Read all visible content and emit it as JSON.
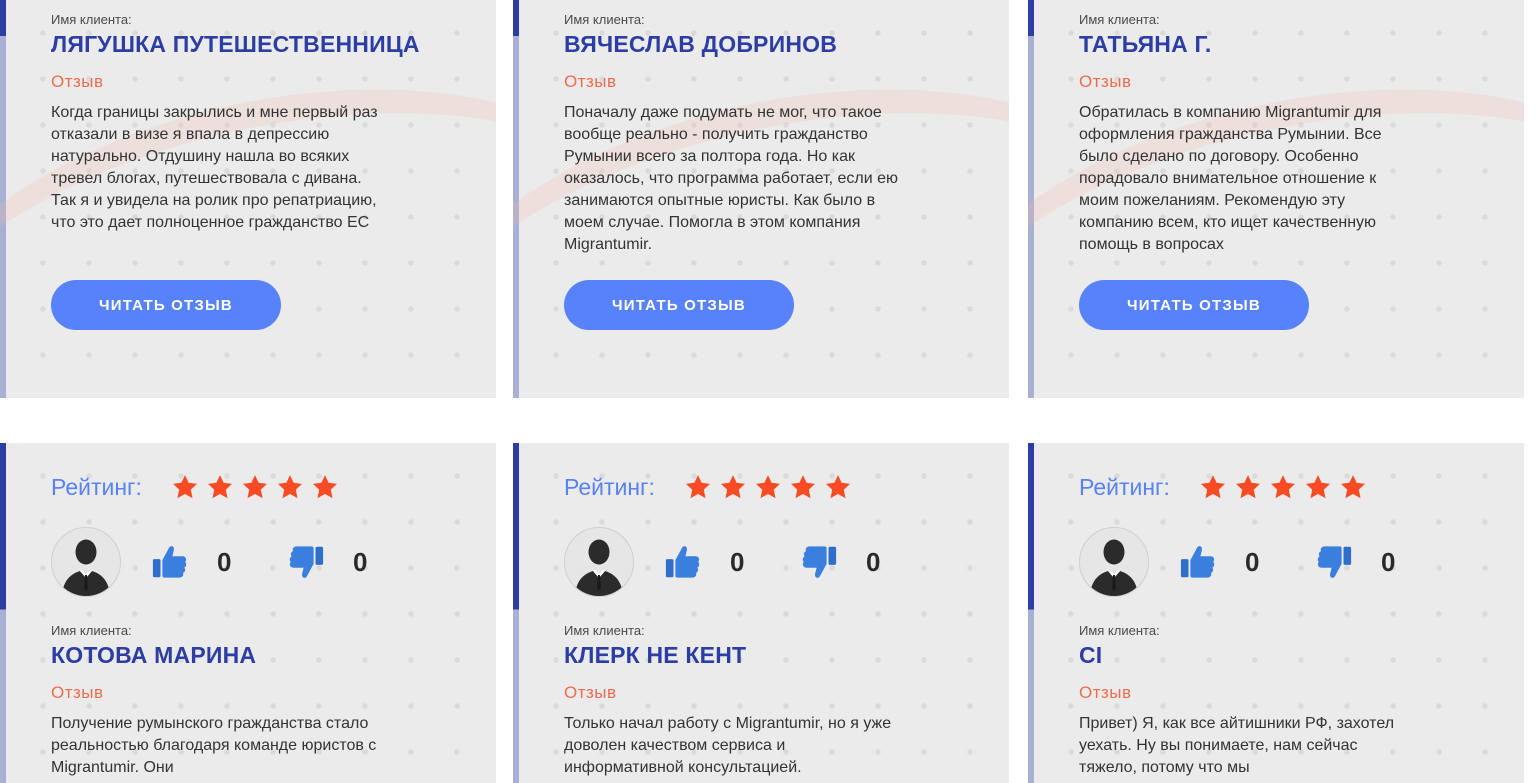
{
  "labels": {
    "client_label": "Имя клиента:",
    "review_label": "Отзыв",
    "read_button": "ЧИТАТЬ ОТЗЫВ",
    "rating_label": "Рейтинг:"
  },
  "colors": {
    "accent_blue": "#2c3ea3",
    "button_blue": "#5882f9",
    "review_orange": "#ef6b4d",
    "star_red": "#fa4b24"
  },
  "icons": {
    "thumb_up": "thumbs-up-icon",
    "thumb_down": "thumbs-down-icon",
    "avatar": "user-avatar-icon",
    "star": "star-icon"
  },
  "reviews_top": [
    {
      "name": "ЛЯГУШКА ПУТЕШЕСТВЕННИЦА",
      "text": "Когда границы закрылись и мне первый раз отказали в визе я впала в депрессию натурально. Отдушину нашла во всяких тревел блогах, путешествовала с дивана. Так я и увидела на ролик про репатриацию, что это дает полноценное гражданство ЕС"
    },
    {
      "name": "ВЯЧЕСЛАВ ДОБРИНОВ",
      "text": "Поначалу даже подумать не мог, что такое вообще реально - получить гражданство Румынии всего за полтора года. Но как оказалось, что программа работает, если ею занимаются опытные юристы. Как было в моем случае. Помогла в этом компания Migrantumir."
    },
    {
      "name": "ТАТЬЯНА Г.",
      "text": "Обратилась в компанию Migrantumir для оформления гражданства Румынии. Все было сделано по договору. Особенно порадовало внимательное отношение к моим пожеланиям. Рекомендую эту компанию всем, кто ищет качественную помощь в вопросах"
    }
  ],
  "reviews_bottom": [
    {
      "rating": 5,
      "likes": "0",
      "dislikes": "0",
      "name": "КОТОВА МАРИНА",
      "text": "Получение румынского гражданства стало реальностью благодаря команде юристов с Migrantumir. Они"
    },
    {
      "rating": 5,
      "likes": "0",
      "dislikes": "0",
      "name": "КЛЕРК НЕ КЕНТ",
      "text": "Только начал работу с Migrantumir, но я уже доволен качеством сервиса и информативной консультацией."
    },
    {
      "rating": 5,
      "likes": "0",
      "dislikes": "0",
      "name": "CI",
      "text": "Привет) Я, как все айтишники РФ, захотел уехать. Ну вы понимаете, нам сейчас тяжело, потому что мы"
    }
  ]
}
